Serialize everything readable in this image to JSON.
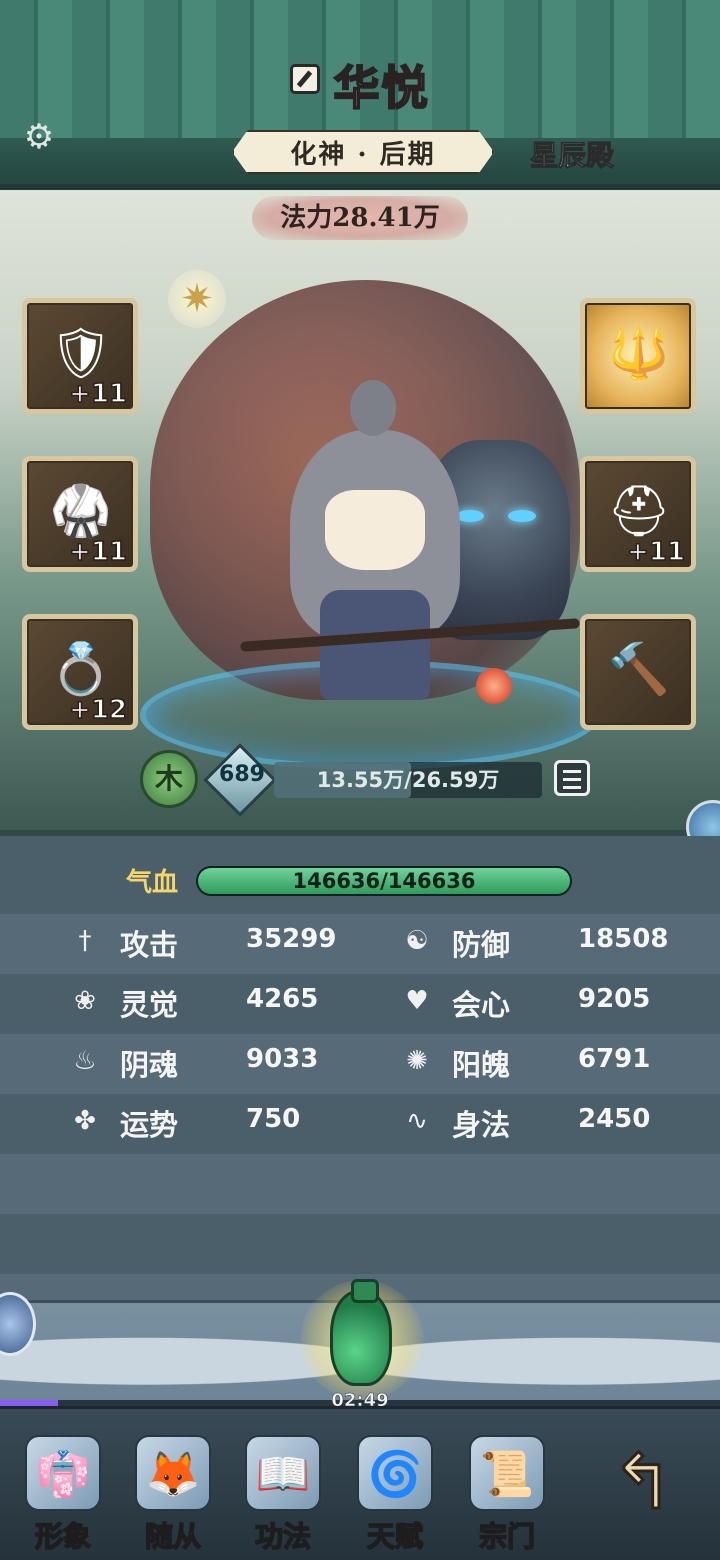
{
  "header": {
    "player_name": "华悦",
    "realm": "化神 · 后期",
    "sect": "星辰殿",
    "settings_icon": "gear-icon",
    "edit_icon": "edit-icon"
  },
  "scene": {
    "power_label": "法力28.41万",
    "element": "木",
    "level": "689",
    "exp_text": "13.55万/26.59万",
    "exp_fraction": 0.51,
    "left_equipment": [
      {
        "icon": "armor-icon",
        "level": "+11"
      },
      {
        "icon": "chest-armor-icon",
        "level": "+11"
      },
      {
        "icon": "ring-icon",
        "level": "+12"
      }
    ],
    "right_equipment": [
      {
        "icon": "spear-weapon-icon",
        "level": ""
      },
      {
        "icon": "helmet-icon",
        "level": "+11"
      },
      {
        "icon": "mace-icon",
        "level": ""
      }
    ]
  },
  "stats": {
    "hp_label": "气血",
    "hp_text": "146636/146636",
    "hp_fraction": 1.0,
    "rows": [
      {
        "left": {
          "icon": "sword-icon",
          "label": "攻击",
          "value": "35299"
        },
        "right": {
          "icon": "yin-yang-icon",
          "label": "防御",
          "value": "18508"
        }
      },
      {
        "left": {
          "icon": "lotus-icon",
          "label": "灵觉",
          "value": "4265"
        },
        "right": {
          "icon": "heart-icon",
          "label": "会心",
          "value": "9205"
        }
      },
      {
        "left": {
          "icon": "flame-icon",
          "label": "阴魂",
          "value": "9033"
        },
        "right": {
          "icon": "swirl-flame-icon",
          "label": "阳魄",
          "value": "6791"
        }
      },
      {
        "left": {
          "icon": "clover-icon",
          "label": "运势",
          "value": "750"
        },
        "right": {
          "icon": "wind-icon",
          "label": "身法",
          "value": "2450"
        }
      }
    ]
  },
  "gourd": {
    "timer": "02:49",
    "progress_fraction": 0.08
  },
  "nav": {
    "items": [
      {
        "label": "形象",
        "icon": "robe-icon"
      },
      {
        "label": "随从",
        "icon": "fox-icon"
      },
      {
        "label": "功法",
        "icon": "book-icon"
      },
      {
        "label": "天赋",
        "icon": "vortex-icon"
      },
      {
        "label": "宗门",
        "icon": "sect-scroll-icon"
      }
    ],
    "back_icon": "back-arrow-icon"
  }
}
